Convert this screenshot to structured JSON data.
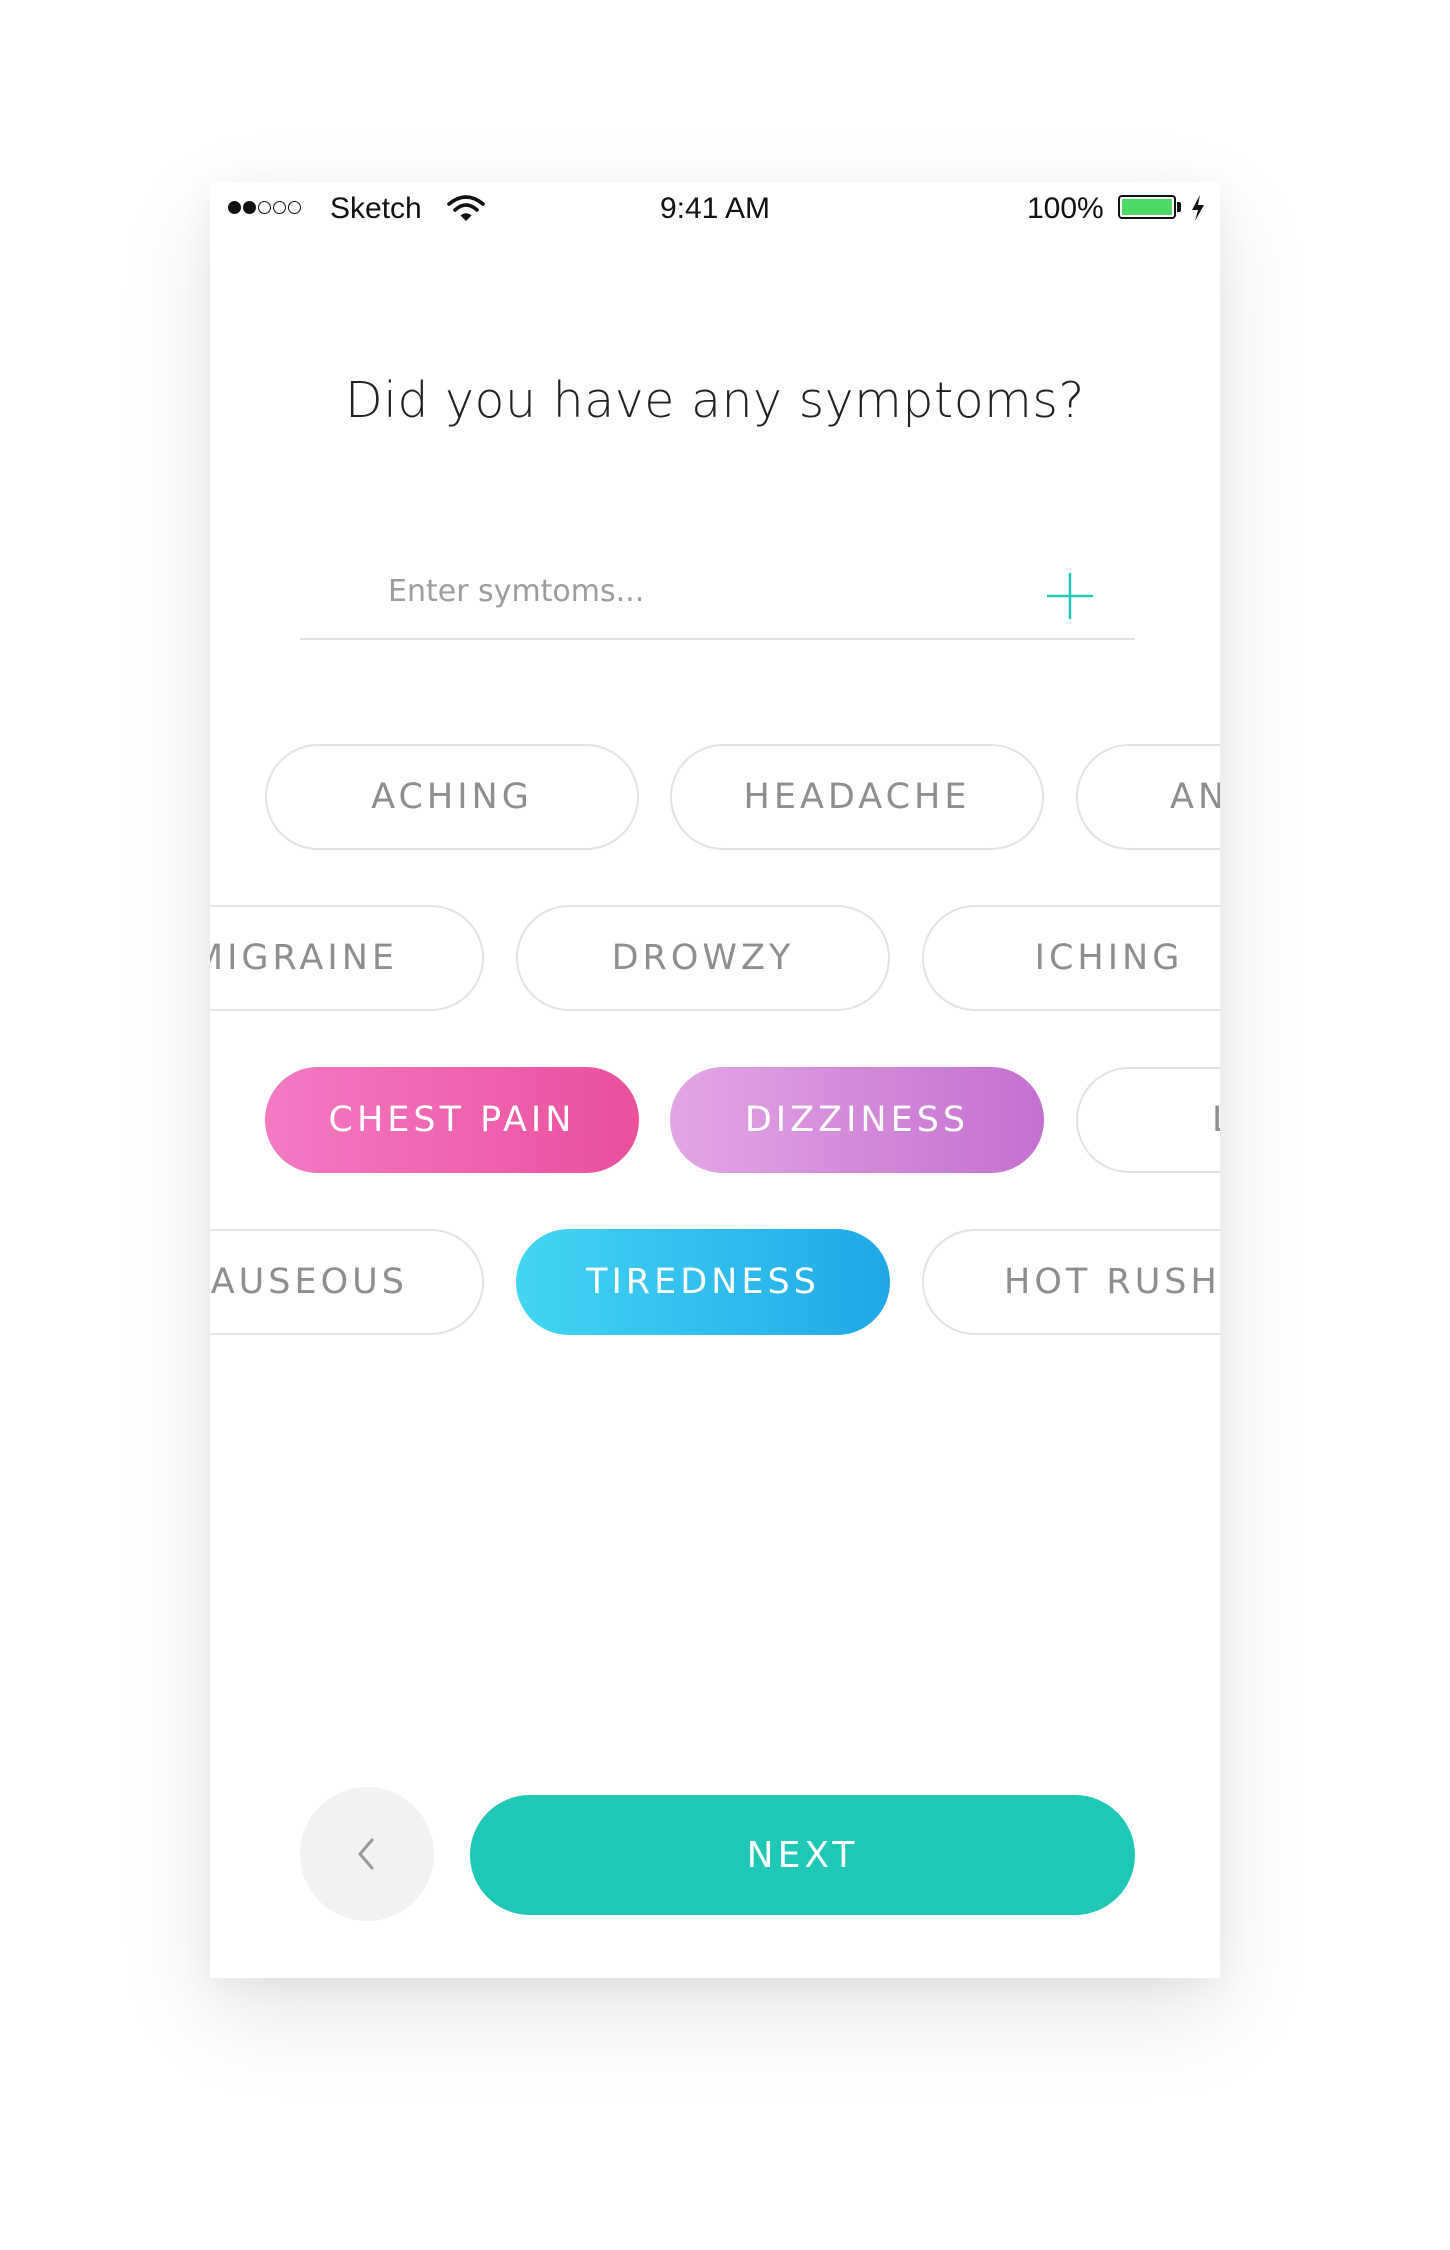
{
  "status_bar": {
    "carrier": "Sketch",
    "time": "9:41 AM",
    "battery": "100%",
    "battery_color": "#4cd964"
  },
  "question": {
    "title": "Did you have any symptoms?"
  },
  "symptom_input": {
    "placeholder": "Enter symtoms...",
    "add_icon": "plus-icon",
    "accent_color": "#1fc8b6"
  },
  "symptom_chips": {
    "row1": [
      "ACHING",
      "HEADACHE",
      "AN"
    ],
    "row2": [
      "MIGRAINE",
      "DROWZY",
      "ICHING"
    ],
    "row3": [
      "CHEST PAIN",
      "DIZZINESS",
      "L"
    ],
    "row4": [
      "AUSEOUS",
      "TIREDNESS",
      "HOT RUSH"
    ],
    "selected": [
      "CHEST PAIN",
      "DIZZINESS",
      "TIREDNESS"
    ],
    "selected_colors": {
      "CHEST PAIN": "#ea4f9d",
      "DIZZINESS": "#c46fd0",
      "TIREDNESS": "#1fa8e6"
    }
  },
  "navigation": {
    "back_icon": "chevron-left-icon",
    "next_label": "NEXT",
    "next_color": "#1fc8b6"
  }
}
